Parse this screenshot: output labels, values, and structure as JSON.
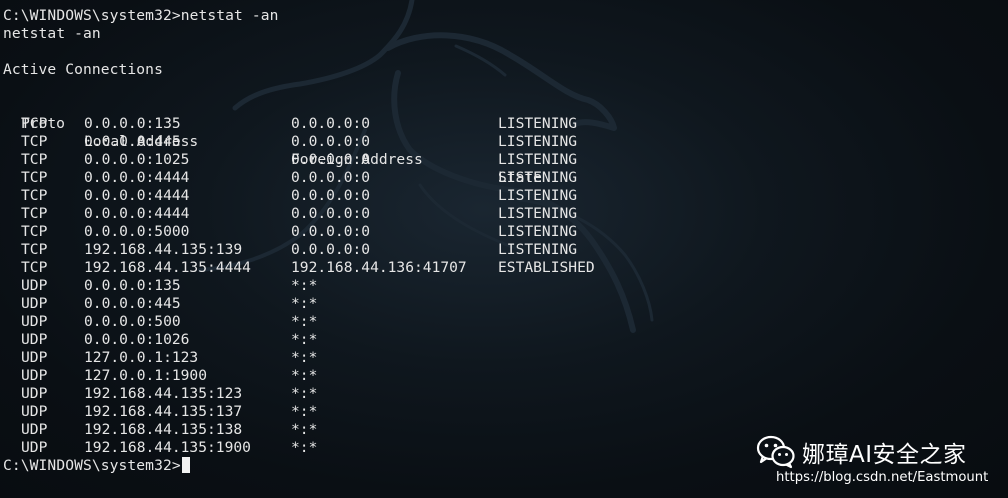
{
  "terminal": {
    "command_line": "C:\\WINDOWS\\system32>netstat -an",
    "echo_line": "netstat -an",
    "section_title": "Active Connections",
    "headers": {
      "proto": "Proto",
      "local": "Local Address",
      "foreign": "Foreign Address",
      "state": "State"
    },
    "rows": [
      {
        "proto": "TCP",
        "local": "0.0.0.0:135",
        "foreign": "0.0.0.0:0",
        "state": "LISTENING"
      },
      {
        "proto": "TCP",
        "local": "0.0.0.0:445",
        "foreign": "0.0.0.0:0",
        "state": "LISTENING"
      },
      {
        "proto": "TCP",
        "local": "0.0.0.0:1025",
        "foreign": "0.0.0.0:0",
        "state": "LISTENING"
      },
      {
        "proto": "TCP",
        "local": "0.0.0.0:4444",
        "foreign": "0.0.0.0:0",
        "state": "LISTENING"
      },
      {
        "proto": "TCP",
        "local": "0.0.0.0:4444",
        "foreign": "0.0.0.0:0",
        "state": "LISTENING"
      },
      {
        "proto": "TCP",
        "local": "0.0.0.0:4444",
        "foreign": "0.0.0.0:0",
        "state": "LISTENING"
      },
      {
        "proto": "TCP",
        "local": "0.0.0.0:5000",
        "foreign": "0.0.0.0:0",
        "state": "LISTENING"
      },
      {
        "proto": "TCP",
        "local": "192.168.44.135:139",
        "foreign": "0.0.0.0:0",
        "state": "LISTENING"
      },
      {
        "proto": "TCP",
        "local": "192.168.44.135:4444",
        "foreign": "192.168.44.136:41707",
        "state": "ESTABLISHED"
      },
      {
        "proto": "UDP",
        "local": "0.0.0.0:135",
        "foreign": "*:*",
        "state": ""
      },
      {
        "proto": "UDP",
        "local": "0.0.0.0:445",
        "foreign": "*:*",
        "state": ""
      },
      {
        "proto": "UDP",
        "local": "0.0.0.0:500",
        "foreign": "*:*",
        "state": ""
      },
      {
        "proto": "UDP",
        "local": "0.0.0.0:1026",
        "foreign": "*:*",
        "state": ""
      },
      {
        "proto": "UDP",
        "local": "127.0.0.1:123",
        "foreign": "*:*",
        "state": ""
      },
      {
        "proto": "UDP",
        "local": "127.0.0.1:1900",
        "foreign": "*:*",
        "state": ""
      },
      {
        "proto": "UDP",
        "local": "192.168.44.135:123",
        "foreign": "*:*",
        "state": ""
      },
      {
        "proto": "UDP",
        "local": "192.168.44.135:137",
        "foreign": "*:*",
        "state": ""
      },
      {
        "proto": "UDP",
        "local": "192.168.44.135:138",
        "foreign": "*:*",
        "state": ""
      },
      {
        "proto": "UDP",
        "local": "192.168.44.135:1900",
        "foreign": "*:*",
        "state": ""
      }
    ],
    "prompt": "C:\\WINDOWS\\system32>"
  },
  "watermark": {
    "icon": "wechat-icon",
    "title": "娜璋AI安全之家",
    "url": "https://blog.csdn.net/Eastmount"
  },
  "background": {
    "logo": "kali-dragon-icon",
    "color": "#0c1218"
  }
}
